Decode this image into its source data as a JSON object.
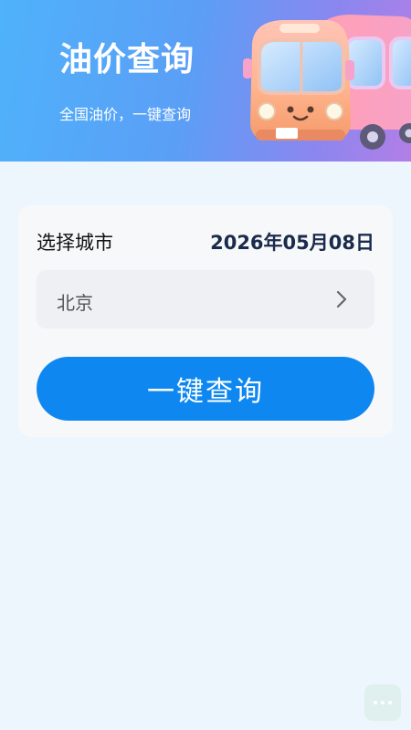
{
  "header": {
    "title": "油价查询",
    "subtitle": "全国油价，一键查询",
    "illustration": "bus-illustration"
  },
  "form": {
    "city_label": "选择城市",
    "date": "2026年05月08日",
    "city_value": "北京",
    "query_button": "一键查询"
  },
  "icons": {
    "chevron": "chevron-right-icon",
    "more": "more-dots-icon"
  },
  "colors": {
    "accent": "#0e88f0",
    "page_background": "#eef6fd",
    "date_text": "#1b2b4c"
  }
}
